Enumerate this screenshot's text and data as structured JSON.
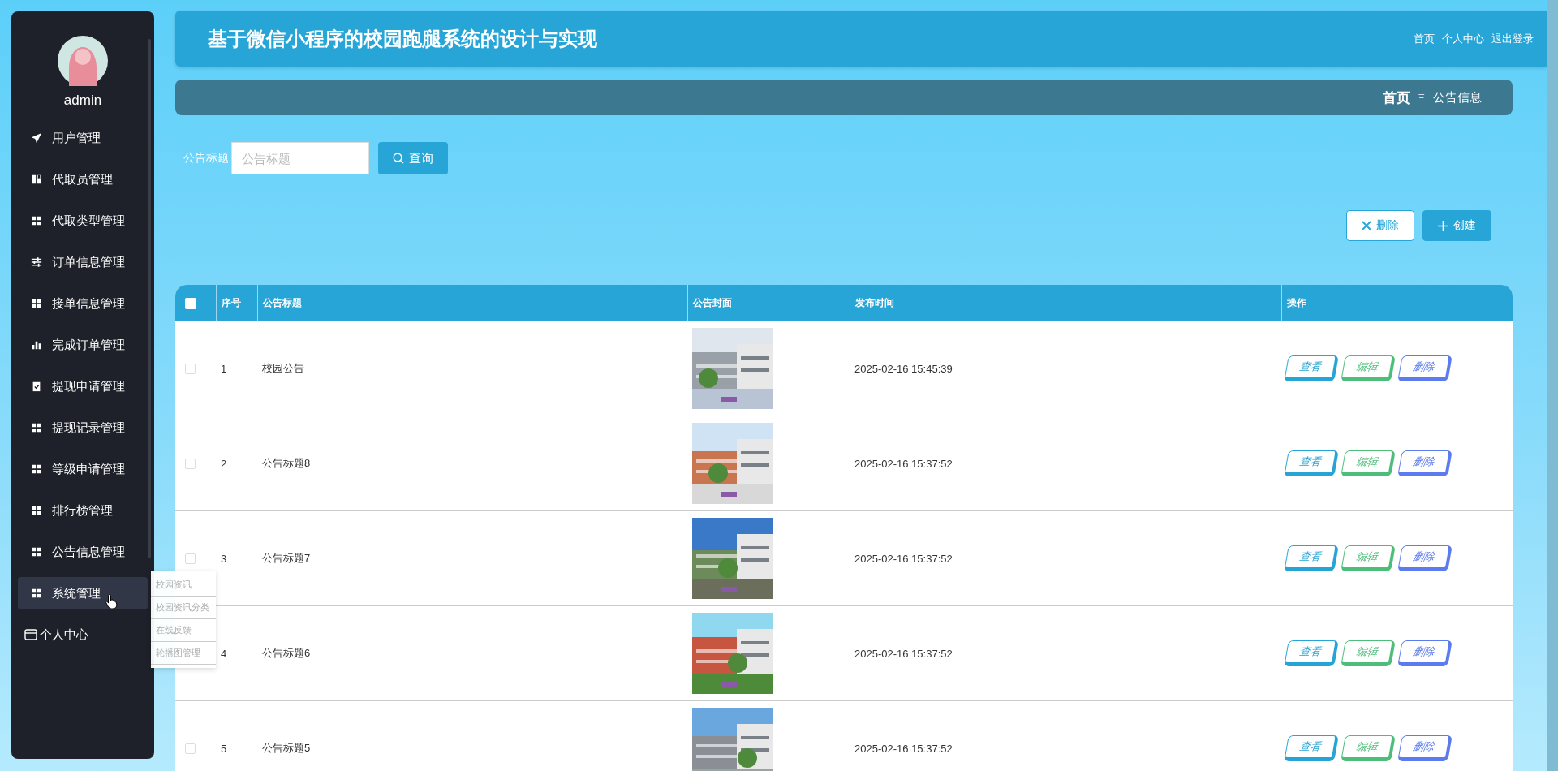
{
  "sidebar": {
    "user": "admin",
    "items": [
      {
        "label": "用户管理",
        "kind": "send",
        "selected": false
      },
      {
        "label": "代取员管理",
        "kind": "book",
        "selected": false
      },
      {
        "label": "代取类型管理",
        "kind": "grid",
        "selected": false
      },
      {
        "label": "订单信息管理",
        "kind": "sliders",
        "selected": false
      },
      {
        "label": "接单信息管理",
        "kind": "grid",
        "selected": false
      },
      {
        "label": "完成订单管理",
        "kind": "chart",
        "selected": false
      },
      {
        "label": "提现申请管理",
        "kind": "clipboard",
        "selected": false
      },
      {
        "label": "提现记录管理",
        "kind": "grid",
        "selected": false
      },
      {
        "label": "等级申请管理",
        "kind": "grid",
        "selected": false
      },
      {
        "label": "排行榜管理",
        "kind": "grid",
        "selected": false
      },
      {
        "label": "公告信息管理",
        "kind": "grid",
        "selected": false
      },
      {
        "label": "系统管理",
        "kind": "grid",
        "selected": true
      }
    ],
    "profile": {
      "label": "个人中心"
    },
    "submenu": [
      "校园资讯",
      "校园资讯分类",
      "在线反馈",
      "轮播图管理"
    ]
  },
  "header": {
    "title": "基于微信小程序的校园跑腿系统的设计与实现",
    "links": [
      "首页",
      "个人中心",
      "退出登录"
    ]
  },
  "breadcrumb": {
    "home": "首页",
    "separator": "Ξ",
    "current": "公告信息"
  },
  "search": {
    "label": "公告标题",
    "placeholder": "公告标题",
    "button": "查询"
  },
  "toolbar": {
    "delete": "删除",
    "create": "创建"
  },
  "table": {
    "all_checked": false,
    "columns": [
      "序号",
      "公告标题",
      "公告封面",
      "发布时间",
      "操作"
    ],
    "rows": [
      {
        "checked": false,
        "index": "1",
        "title": "校园公告",
        "cover": {
          "kind": "picture"
        },
        "time": "2025-02-16 15:45:39",
        "actions": [
          {
            "label": "查看",
            "color": "#26a4d6"
          },
          {
            "label": "编辑",
            "color": "#4dbd7a"
          },
          {
            "label": "删除",
            "color": "#5b7bef"
          }
        ]
      },
      {
        "checked": false,
        "index": "2",
        "title": "公告标题8",
        "cover": {
          "kind": "picture"
        },
        "time": "2025-02-16 15:37:52",
        "actions": [
          {
            "label": "查看",
            "color": "#26a4d6"
          },
          {
            "label": "编辑",
            "color": "#4dbd7a"
          },
          {
            "label": "删除",
            "color": "#5b7bef"
          }
        ]
      },
      {
        "checked": false,
        "index": "3",
        "title": "公告标题7",
        "cover": {
          "kind": "picture"
        },
        "time": "2025-02-16 15:37:52",
        "actions": [
          {
            "label": "查看",
            "color": "#26a4d6"
          },
          {
            "label": "编辑",
            "color": "#4dbd7a"
          },
          {
            "label": "删除",
            "color": "#5b7bef"
          }
        ]
      },
      {
        "index": "4",
        "title": "公告标题6",
        "cover": {
          "kind": "picture"
        },
        "time": "2025-02-16 15:37:52",
        "actions": [
          {
            "label": "查看",
            "color": "#26a4d6"
          },
          {
            "label": "编辑",
            "color": "#4dbd7a"
          },
          {
            "label": "删除",
            "color": "#5b7bef"
          }
        ]
      },
      {
        "checked": false,
        "index": "5",
        "title": "公告标题5",
        "cover": {
          "kind": "picture"
        },
        "time": "2025-02-16 15:37:52",
        "actions": [
          {
            "label": "查看",
            "color": "#26a4d6"
          },
          {
            "label": "编辑",
            "color": "#4dbd7a"
          },
          {
            "label": "删除",
            "color": "#5b7bef"
          }
        ]
      }
    ]
  }
}
